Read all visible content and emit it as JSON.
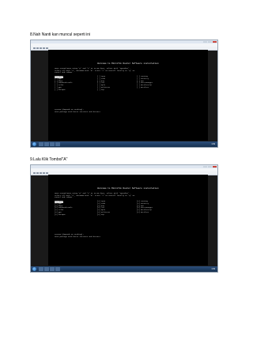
{
  "step8": {
    "caption": "8.Nah Nanti kan muncul seperti ini"
  },
  "step9": {
    "caption": "9.Lalu Klik Tombol\"A\""
  },
  "screen": {
    "title": "Welcome to MikroTik Router Software installation",
    "instructions": [
      "Move around menu using 'p' and 'n' or arrow keys, select with 'spacebar'.",
      "Select all with 'a', minimum with 'm'. Press 'i' to install locally or 'q' to",
      "cancel and reboot."
    ],
    "footer": [
      "system (depends on nothing):",
      "Main package with basic services and drivers"
    ]
  },
  "shot_a": {
    "col1": [
      "[X] system",
      "[ ] ppp",
      "[ ] dhcp",
      "[ ] advanced-tools",
      "[ ] calea",
      "[ ] gps",
      "[ ] hotspot"
    ],
    "col2": [
      "[ ] ipv6",
      "[ ] isdn",
      "[ ] kvm",
      "[ ] lcd",
      "[ ] mpls",
      "[ ] multicast",
      "[ ] ntp"
    ],
    "col3": [
      "[ ] routing",
      "[ ] security",
      "[ ] ups",
      "[ ] user-manager",
      "[ ] wireless-fp",
      "[ ] wireless"
    ]
  },
  "shot_b": {
    "col1": [
      "[X] system",
      "[X] ppp",
      "[X] dhcp",
      "[X] advanced-tools",
      "[X] calea",
      "[X] gps",
      "[X] hotspot"
    ],
    "col2": [
      "[X] ipv6",
      "[X] isdn",
      "[X] kvm",
      "[X] lcd",
      "[X] mpls",
      "[X] multicast",
      "[X] ntp"
    ],
    "col3": [
      "[X] routing",
      "[X] security",
      "[X] ups",
      "[X] user-manager",
      "[X] wireless-fp",
      "[X] wireless"
    ]
  },
  "taskbar": {
    "time": "1:09"
  }
}
